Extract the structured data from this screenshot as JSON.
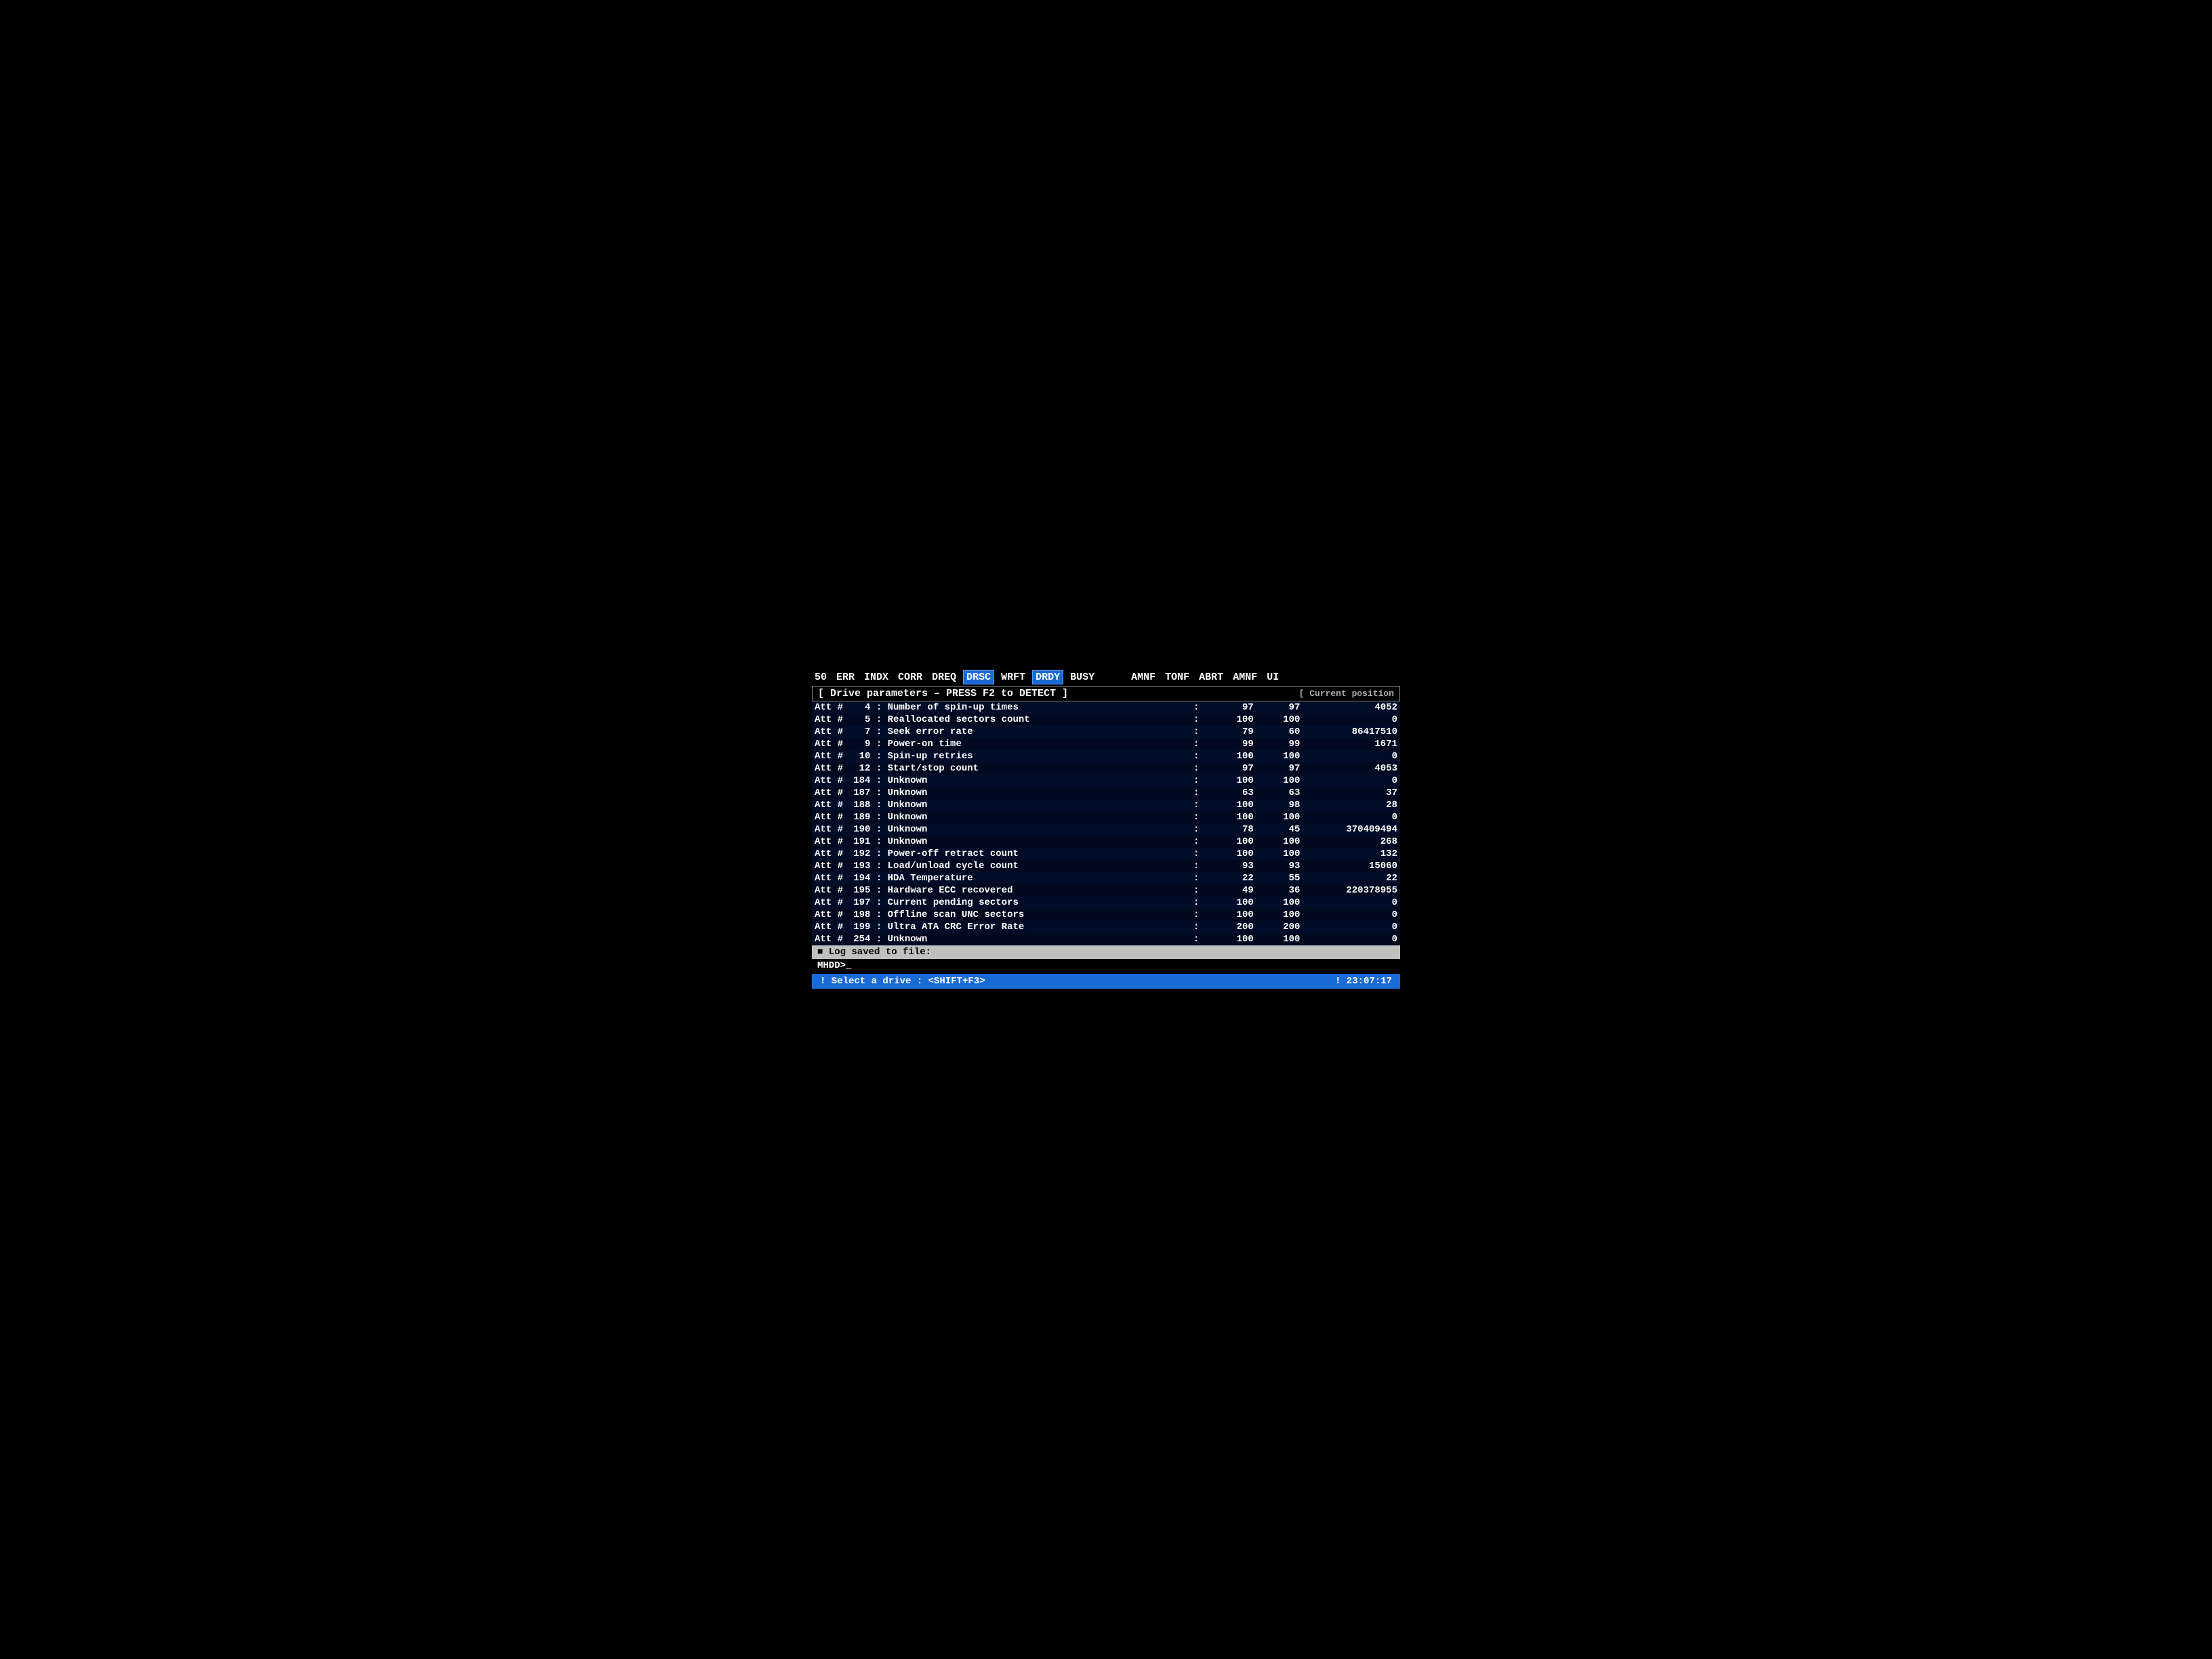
{
  "topbar": {
    "items": [
      "50",
      "ERR",
      "INDX",
      "CORR",
      "DREQ",
      "DRSC",
      "WRFT",
      "DRDY",
      "BUSY",
      "AMNF",
      "TONF",
      "ABRT",
      "AMNF",
      "UI"
    ],
    "highlighted": [
      "DRSC",
      "DRDY"
    ]
  },
  "drive_params": {
    "label": "[ Drive parameters – PRESS F2 to DETECT ]",
    "right": "[ Current position"
  },
  "attributes": [
    {
      "num": "4",
      "name": "Number of spin-up times",
      "val1": "97",
      "val2": "97",
      "val3": "4052"
    },
    {
      "num": "5",
      "name": "Reallocated sectors count",
      "val1": "100",
      "val2": "100",
      "val3": "0"
    },
    {
      "num": "7",
      "name": "Seek error rate",
      "val1": "79",
      "val2": "60",
      "val3": "86417510"
    },
    {
      "num": "9",
      "name": "Power-on time",
      "val1": "99",
      "val2": "99",
      "val3": "1671"
    },
    {
      "num": "10",
      "name": "Spin-up retries",
      "val1": "100",
      "val2": "100",
      "val3": "0"
    },
    {
      "num": "12",
      "name": "Start/stop count",
      "val1": "97",
      "val2": "97",
      "val3": "4053"
    },
    {
      "num": "184",
      "name": "Unknown",
      "val1": "100",
      "val2": "100",
      "val3": "0"
    },
    {
      "num": "187",
      "name": "Unknown",
      "val1": "63",
      "val2": "63",
      "val3": "37"
    },
    {
      "num": "188",
      "name": "Unknown",
      "val1": "100",
      "val2": "98",
      "val3": "28"
    },
    {
      "num": "189",
      "name": "Unknown",
      "val1": "100",
      "val2": "100",
      "val3": "0"
    },
    {
      "num": "190",
      "name": "Unknown",
      "val1": "78",
      "val2": "45",
      "val3": "370409494"
    },
    {
      "num": "191",
      "name": "Unknown",
      "val1": "100",
      "val2": "100",
      "val3": "268"
    },
    {
      "num": "192",
      "name": "Power-off retract count",
      "val1": "100",
      "val2": "100",
      "val3": "132"
    },
    {
      "num": "193",
      "name": "Load/unload cycle count",
      "val1": "93",
      "val2": "93",
      "val3": "15060"
    },
    {
      "num": "194",
      "name": "HDA Temperature",
      "val1": "22",
      "val2": "55",
      "val3": "22"
    },
    {
      "num": "195",
      "name": "Hardware ECC recovered",
      "val1": "49",
      "val2": "36",
      "val3": "220378955"
    },
    {
      "num": "197",
      "name": "Current pending sectors",
      "val1": "100",
      "val2": "100",
      "val3": "0"
    },
    {
      "num": "198",
      "name": "Offline scan UNC sectors",
      "val1": "100",
      "val2": "100",
      "val3": "0"
    },
    {
      "num": "199",
      "name": "Ultra ATA CRC Error Rate",
      "val1": "200",
      "val2": "200",
      "val3": "0"
    },
    {
      "num": "254",
      "name": "Unknown",
      "val1": "100",
      "val2": "100",
      "val3": "0"
    }
  ],
  "log_bar": {
    "text": "■ Log saved to file:"
  },
  "cmd_bar": {
    "text": "MHDD>_"
  },
  "status_bar": {
    "left": "! Select a drive : <SHIFT+F3>",
    "right": "! 23:07:17"
  }
}
